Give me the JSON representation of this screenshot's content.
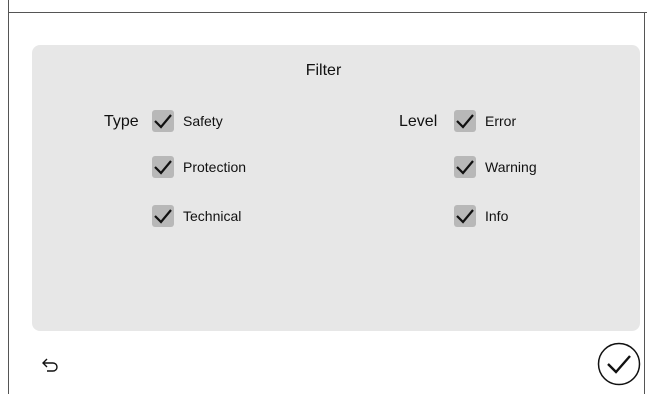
{
  "filter": {
    "title": "Filter",
    "type": {
      "label": "Type",
      "options": [
        {
          "label": "Safety",
          "checked": true
        },
        {
          "label": "Protection",
          "checked": true
        },
        {
          "label": "Technical",
          "checked": true
        }
      ]
    },
    "level": {
      "label": "Level",
      "options": [
        {
          "label": "Error",
          "checked": true
        },
        {
          "label": "Warning",
          "checked": true
        },
        {
          "label": "Info",
          "checked": true
        }
      ]
    }
  },
  "footer": {
    "back_icon": "undo-arrow-icon",
    "confirm_icon": "check-circle-icon"
  },
  "colors": {
    "panel_bg": "#e7e7e7",
    "checkbox_bg": "#b8b8b8",
    "check": "#111111"
  }
}
